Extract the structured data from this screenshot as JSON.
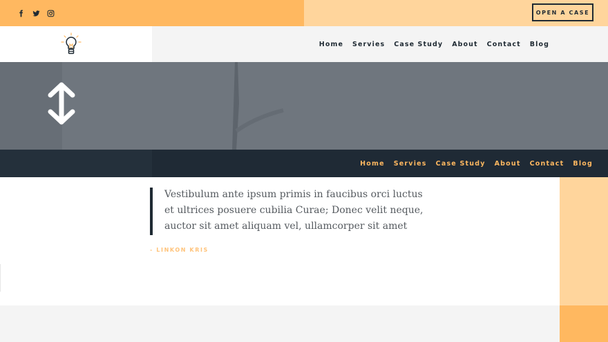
{
  "colors": {
    "accent_orange": "#ffb860",
    "accent_light": "#ffd59c",
    "dark": "#1f2a33",
    "hero_grey": "#6f767e"
  },
  "topbar": {
    "social": [
      {
        "name": "facebook-icon"
      },
      {
        "name": "twitter-icon"
      },
      {
        "name": "instagram-icon"
      }
    ],
    "cta_label": "OPEN A CASE"
  },
  "header": {
    "logo_icon": "lightbulb-icon",
    "nav": [
      "Home",
      "Servies",
      "Case Study",
      "About",
      "Contact",
      "Blog"
    ]
  },
  "hero": {
    "icon": "up-down-arrow-icon"
  },
  "subnav": {
    "items": [
      "Home",
      "Servies",
      "Case Study",
      "About",
      "Contact",
      "Blog"
    ]
  },
  "quote": {
    "text": "Vestibulum ante ipsum primis in faucibus orci luctus et ultrices posuere cubilia Curae; Donec velit neque, auctor sit amet aliquam vel, ullamcorper sit amet",
    "author": "- LINKON KRIS"
  }
}
